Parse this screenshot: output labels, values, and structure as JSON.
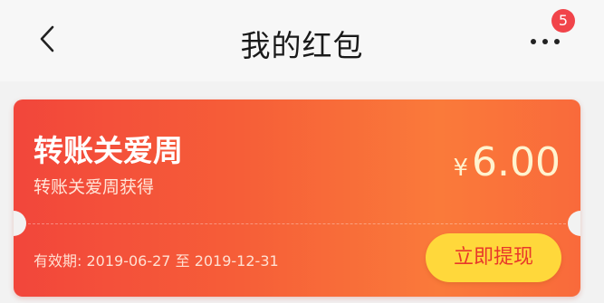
{
  "header": {
    "title": "我的红包",
    "notification_count": "5"
  },
  "coupon": {
    "title": "转账关爱周",
    "subtitle": "转账关爱周获得",
    "currency": "¥",
    "amount": "6.00",
    "validity_label": "有效期:",
    "valid_from": "2019-06-27",
    "separator": "至",
    "valid_to": "2019-12-31",
    "action_label": "立即提现"
  },
  "colors": {
    "card_start": "#f2463b",
    "card_end": "#fa7a3a",
    "button_bg": "#ffd83b",
    "button_text": "#e8382a",
    "badge": "#f1444a"
  }
}
